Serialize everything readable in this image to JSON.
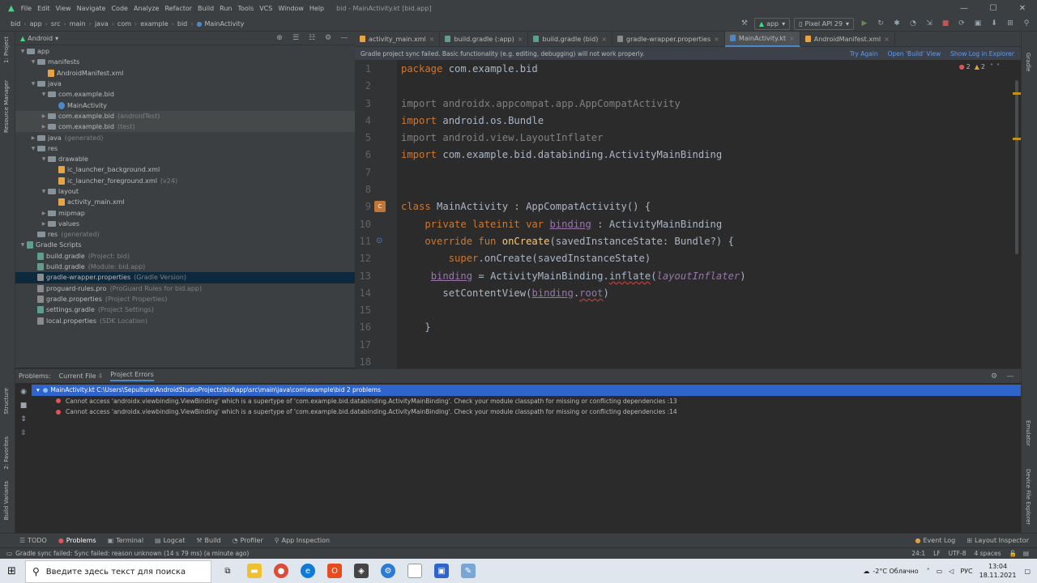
{
  "window": {
    "title": "bid - MainActivity.kt [bid.app]",
    "menu": [
      "File",
      "Edit",
      "View",
      "Navigate",
      "Code",
      "Analyze",
      "Refactor",
      "Build",
      "Run",
      "Tools",
      "VCS",
      "Window",
      "Help"
    ],
    "minimize": "—",
    "maximize": "☐",
    "close": "✕"
  },
  "breadcrumb": [
    "bid",
    "app",
    "src",
    "main",
    "java",
    "com",
    "example",
    "bid",
    "MainActivity"
  ],
  "toolbar": {
    "run_config": "app",
    "device": "Pixel API 29"
  },
  "left_strip": {
    "project": "1: Project",
    "resource_manager": "Resource Manager",
    "structure": "Structure",
    "favorites": "2: Favorites",
    "build_variants": "Build Variants"
  },
  "right_strip": {
    "gradle": "Gradle",
    "emulator": "Emulator",
    "device_explorer": "Device File Explorer"
  },
  "project_panel": {
    "view_mode": "Android",
    "tree": [
      {
        "indent": 0,
        "arrow": "▼",
        "icon": "folder",
        "label": "app",
        "extra": ""
      },
      {
        "indent": 1,
        "arrow": "▼",
        "icon": "folder",
        "label": "manifests",
        "extra": ""
      },
      {
        "indent": 2,
        "arrow": "",
        "icon": "xml",
        "label": "AndroidManifest.xml",
        "extra": ""
      },
      {
        "indent": 1,
        "arrow": "▼",
        "icon": "folder",
        "label": "java",
        "extra": ""
      },
      {
        "indent": 2,
        "arrow": "▼",
        "icon": "pkg",
        "label": "com.example.bid",
        "extra": ""
      },
      {
        "indent": 3,
        "arrow": "",
        "icon": "kt",
        "label": "MainActivity",
        "extra": ""
      },
      {
        "indent": 2,
        "arrow": "▶",
        "icon": "pkg",
        "label": "com.example.bid",
        "extra": "(androidTest)",
        "shaded": true
      },
      {
        "indent": 2,
        "arrow": "▶",
        "icon": "pkg",
        "label": "com.example.bid",
        "extra": "(test)",
        "shaded": true
      },
      {
        "indent": 1,
        "arrow": "▶",
        "icon": "folder",
        "label": "java",
        "extra": "(generated)"
      },
      {
        "indent": 1,
        "arrow": "▼",
        "icon": "folder",
        "label": "res",
        "extra": ""
      },
      {
        "indent": 2,
        "arrow": "▼",
        "icon": "folder",
        "label": "drawable",
        "extra": ""
      },
      {
        "indent": 3,
        "arrow": "",
        "icon": "xml",
        "label": "ic_launcher_background.xml",
        "extra": ""
      },
      {
        "indent": 3,
        "arrow": "",
        "icon": "xml",
        "label": "ic_launcher_foreground.xml",
        "extra": "(v24)"
      },
      {
        "indent": 2,
        "arrow": "▼",
        "icon": "folder",
        "label": "layout",
        "extra": ""
      },
      {
        "indent": 3,
        "arrow": "",
        "icon": "xml",
        "label": "activity_main.xml",
        "extra": ""
      },
      {
        "indent": 2,
        "arrow": "▶",
        "icon": "folder",
        "label": "mipmap",
        "extra": ""
      },
      {
        "indent": 2,
        "arrow": "▶",
        "icon": "folder",
        "label": "values",
        "extra": ""
      },
      {
        "indent": 1,
        "arrow": "",
        "icon": "folder",
        "label": "res",
        "extra": "(generated)"
      },
      {
        "indent": 0,
        "arrow": "▼",
        "icon": "gradle",
        "label": "Gradle Scripts",
        "extra": ""
      },
      {
        "indent": 1,
        "arrow": "",
        "icon": "gradle",
        "label": "build.gradle",
        "extra": "(Project: bid)"
      },
      {
        "indent": 1,
        "arrow": "",
        "icon": "gradle",
        "label": "build.gradle",
        "extra": "(Module: bid.app)"
      },
      {
        "indent": 1,
        "arrow": "",
        "icon": "props",
        "label": "gradle-wrapper.properties",
        "extra": "(Gradle Version)",
        "selected": true
      },
      {
        "indent": 1,
        "arrow": "",
        "icon": "props",
        "label": "proguard-rules.pro",
        "extra": "(ProGuard Rules for bid.app)"
      },
      {
        "indent": 1,
        "arrow": "",
        "icon": "props",
        "label": "gradle.properties",
        "extra": "(Project Properties)"
      },
      {
        "indent": 1,
        "arrow": "",
        "icon": "gradle",
        "label": "settings.gradle",
        "extra": "(Project Settings)"
      },
      {
        "indent": 1,
        "arrow": "",
        "icon": "props",
        "label": "local.properties",
        "extra": "(SDK Location)"
      }
    ]
  },
  "editor_tabs": [
    {
      "label": "activity_main.xml",
      "active": false
    },
    {
      "label": "build.gradle (:app)",
      "active": false
    },
    {
      "label": "build.gradle (bid)",
      "active": false
    },
    {
      "label": "gradle-wrapper.properties",
      "active": false
    },
    {
      "label": "MainActivity.kt",
      "active": true
    },
    {
      "label": "AndroidManifest.xml",
      "active": false
    }
  ],
  "banner": {
    "message": "Gradle project sync failed. Basic functionality (e.g. editing, debugging) will not work properly.",
    "try_again": "Try Again",
    "open_build_view": "Open 'Build' View",
    "show_log": "Show Log in Explorer"
  },
  "inspections": {
    "errors": "2",
    "warnings": "2"
  },
  "code_lines": [
    "1",
    "2",
    "3",
    "4",
    "5",
    "6",
    "7",
    "8",
    "9",
    "10",
    "11",
    "12",
    "13",
    "14",
    "15",
    "16",
    "17",
    "18"
  ],
  "problems": {
    "tabs": [
      "Problems:",
      "Current File",
      "4",
      "Project Errors"
    ],
    "file_row": "MainActivity.kt  C:\\Users\\Sepulture\\AndroidStudioProjects\\bid\\app\\src\\main\\java\\com\\example\\bid  2 problems",
    "errors": [
      "Cannot access 'androidx.viewbinding.ViewBinding' which is a supertype of 'com.example.bid.databinding.ActivityMainBinding'. Check your module classpath for missing or conflicting dependencies :13",
      "Cannot access 'androidx.viewbinding.ViewBinding' which is a supertype of 'com.example.bid.databinding.ActivityMainBinding'. Check your module classpath for missing or conflicting dependencies :14"
    ]
  },
  "bottom_tools": [
    "TODO",
    "Problems",
    "Terminal",
    "Logcat",
    "Build",
    "Profiler",
    "App Inspection"
  ],
  "bottom_right_tools": [
    "Event Log",
    "Layout Inspector"
  ],
  "status": {
    "message": "Gradle sync failed: Sync failed: reason unknown (14 s 79 ms) (a minute ago)",
    "position": "24:1",
    "line_sep": "LF",
    "encoding": "UTF-8",
    "indent": "4 spaces"
  },
  "taskbar": {
    "search_placeholder": "Введите здесь текст для поиска",
    "weather": "-2°C  Облачно",
    "lang": "РУС",
    "time": "13:04",
    "date": "18.11.2021"
  }
}
